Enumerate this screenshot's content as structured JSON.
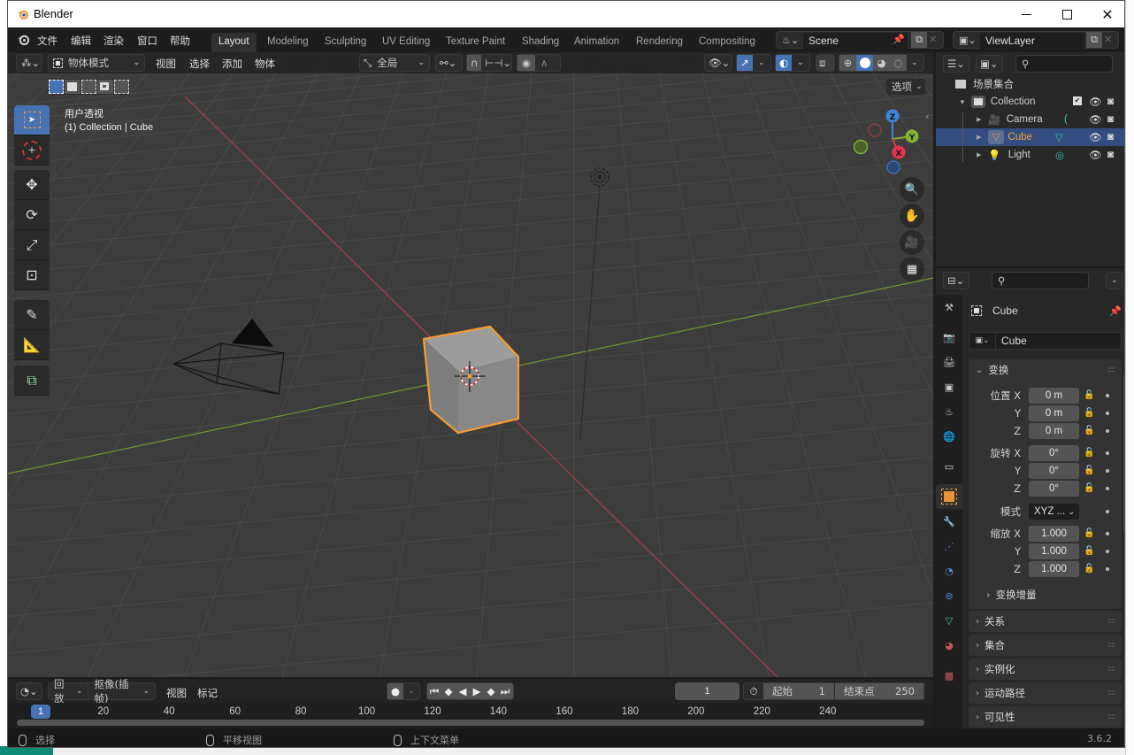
{
  "window": {
    "title": "Blender",
    "controls": {
      "minimize": "—",
      "maximize": "☐",
      "close": "✕"
    }
  },
  "menu": [
    "文件",
    "编辑",
    "渲染",
    "窗口",
    "帮助"
  ],
  "workspaces": [
    "Layout",
    "Modeling",
    "Sculpting",
    "UV Editing",
    "Texture Paint",
    "Shading",
    "Animation",
    "Rendering",
    "Compositing"
  ],
  "active_workspace": "Layout",
  "scene": {
    "name": "Scene"
  },
  "view_layer": {
    "name": "ViewLayer"
  },
  "viewport": {
    "mode": "物体模式",
    "menus": [
      "视图",
      "选择",
      "添加",
      "物体"
    ],
    "transform_orientation": "全局",
    "options_label": "选项",
    "overlay_title": "用户透视",
    "overlay_subtitle": "(1) Collection | Cube",
    "gizmo_axes": [
      "X",
      "Y",
      "Z"
    ],
    "colors": {
      "x_axis": "#c0394c",
      "y_axis": "#6f9a2a",
      "selection": "#f59c32"
    }
  },
  "outliner": {
    "root": "场景集合",
    "collection": "Collection",
    "items": [
      {
        "name": "Camera",
        "type": "camera",
        "selected": false
      },
      {
        "name": "Cube",
        "type": "mesh",
        "selected": true
      },
      {
        "name": "Light",
        "type": "light",
        "selected": false
      }
    ]
  },
  "properties": {
    "object_name": "Cube",
    "object_field": "Cube",
    "transform_header": "变换",
    "location_label": "位置",
    "rotation_label": "旋转",
    "mode_label": "模式",
    "scale_label": "缩放",
    "axes": [
      "X",
      "Y",
      "Z"
    ],
    "location": [
      "0 m",
      "0 m",
      "0 m"
    ],
    "rotation": [
      "0°",
      "0°",
      "0°"
    ],
    "rotation_mode": "XYZ ...",
    "scale": [
      "1.000",
      "1.000",
      "1.000"
    ],
    "delta_transform": "变换增量",
    "collapsed_panels": [
      "关系",
      "集合",
      "实例化",
      "运动路径",
      "可见性"
    ]
  },
  "timeline": {
    "playback": "回放",
    "keying": "抠像(插帧)",
    "menus": [
      "视图",
      "标记"
    ],
    "current_frame": "1",
    "start_label": "起始",
    "start": "1",
    "end_label": "结束点",
    "end": "250",
    "ruler_ticks": [
      "20",
      "40",
      "60",
      "80",
      "100",
      "120",
      "140",
      "160",
      "180",
      "200",
      "220",
      "240"
    ],
    "playhead": "1"
  },
  "statusbar": {
    "left": "选择",
    "middle": "平移视图",
    "right": "上下文菜单",
    "version": "3.6.2"
  }
}
